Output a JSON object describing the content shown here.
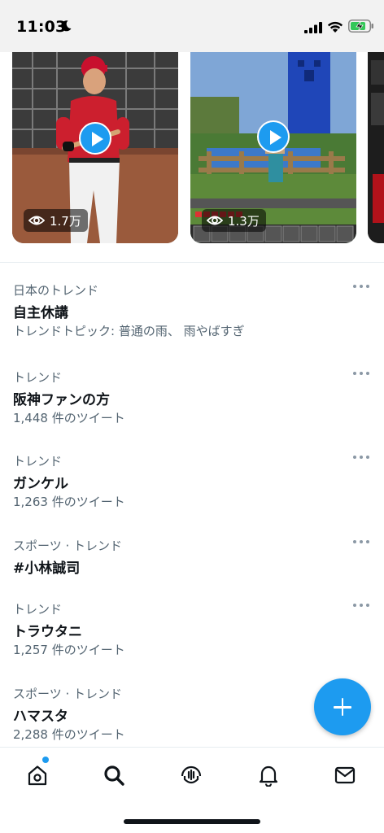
{
  "status_bar": {
    "time": "11:03"
  },
  "media": [
    {
      "views": "1.7万"
    },
    {
      "views": "1.3万"
    }
  ],
  "trends": [
    {
      "category": "日本のトレンド",
      "title": "自主休講",
      "meta": "トレンドトピック: 普通の雨、 雨やばすぎ"
    },
    {
      "category": "トレンド",
      "title": "阪神ファンの方",
      "meta": "1,448 件のツイート"
    },
    {
      "category": "トレンド",
      "title": "ガンケル",
      "meta": "1,263 件のツイート"
    },
    {
      "category": "スポーツ · トレンド",
      "title": "#小林誠司",
      "meta": ""
    },
    {
      "category": "トレンド",
      "title": "トラウタニ",
      "meta": "1,257 件のツイート"
    },
    {
      "category": "スポーツ · トレンド",
      "title": "ハマスタ",
      "meta": "2,288 件のツイート"
    }
  ],
  "tab_bar": {
    "items": [
      "home-icon",
      "search-icon",
      "spaces-icon",
      "notifications-icon",
      "messages-icon"
    ]
  },
  "colors": {
    "accent": "#1d9bf0",
    "secondary_text": "#536471",
    "primary_text": "#0f1419"
  }
}
